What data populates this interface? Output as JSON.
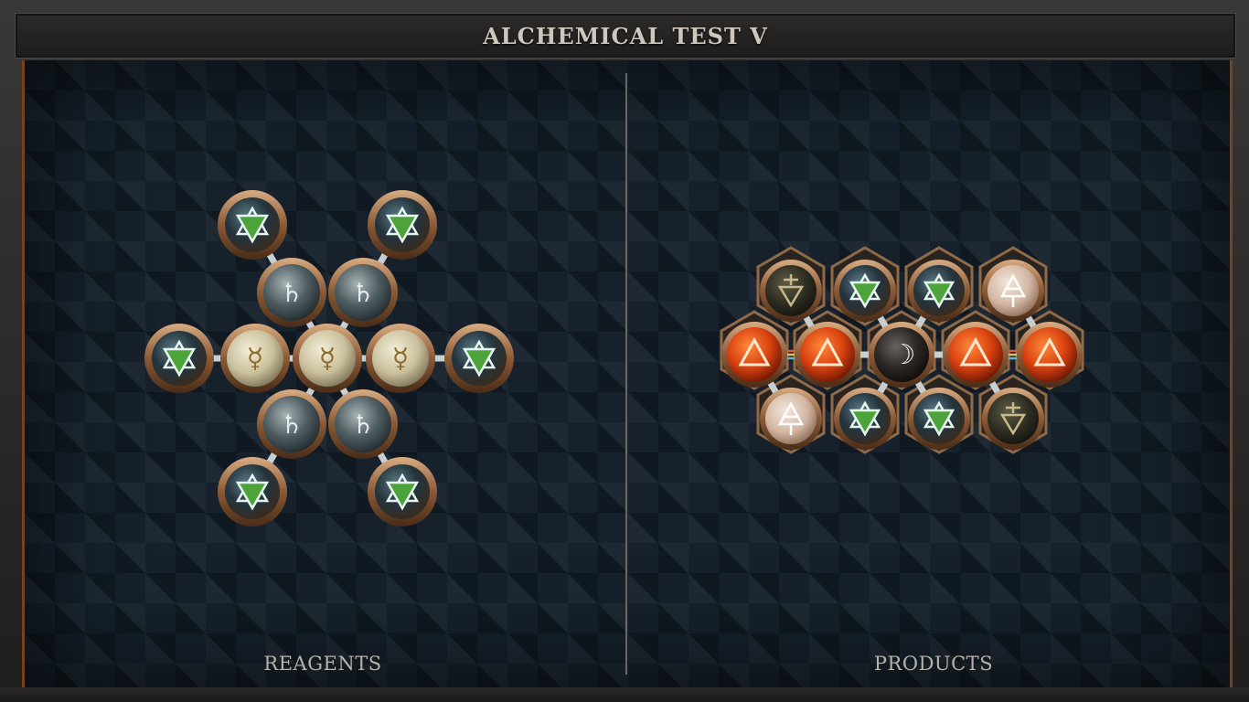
{
  "title": "ALCHEMICAL TEST V",
  "panels": {
    "reagents_label": "REAGENTS",
    "products_label": "PRODUCTS"
  },
  "colors": {
    "frame": "#2b2a29",
    "board": "#16212c",
    "accent_copper": "#7a3f1e",
    "bronze_rim": "#a77a52",
    "fire": "#d9420f",
    "salt": "#2f4754",
    "quicksilver": "#d8d0b4",
    "earth": "#3a3a2a",
    "air": "#d8c4b4",
    "moon": "#2c2c2c"
  },
  "reagent_molecule": {
    "atoms": [
      {
        "id": "salt-tl",
        "element": "salt",
        "symbol": "🜔"
      },
      {
        "id": "salt-tr",
        "element": "salt",
        "symbol": "🜔"
      },
      {
        "id": "lead-ul",
        "element": "lead",
        "symbol": "♄"
      },
      {
        "id": "lead-ur",
        "element": "lead",
        "symbol": "♄"
      },
      {
        "id": "salt-l",
        "element": "salt",
        "symbol": "🜔"
      },
      {
        "id": "qs-l",
        "element": "quicksilver",
        "symbol": "☿"
      },
      {
        "id": "qs-c",
        "element": "quicksilver",
        "symbol": "☿"
      },
      {
        "id": "qs-r",
        "element": "quicksilver",
        "symbol": "☿"
      },
      {
        "id": "salt-r",
        "element": "salt",
        "symbol": "🜔"
      },
      {
        "id": "lead-ll",
        "element": "lead",
        "symbol": "♄"
      },
      {
        "id": "lead-lr",
        "element": "lead",
        "symbol": "♄"
      },
      {
        "id": "salt-bl",
        "element": "salt",
        "symbol": "🜔"
      },
      {
        "id": "salt-br",
        "element": "salt",
        "symbol": "🜔"
      }
    ]
  },
  "product_molecule": {
    "atoms": [
      {
        "id": "earth-t1",
        "element": "earth",
        "symbol": "🜃"
      },
      {
        "id": "salt-t2",
        "element": "salt",
        "symbol": "🜔"
      },
      {
        "id": "salt-t3",
        "element": "salt",
        "symbol": "🜔"
      },
      {
        "id": "air-t4",
        "element": "air",
        "symbol": "🜁"
      },
      {
        "id": "fire-m1",
        "element": "fire",
        "symbol": "🜂"
      },
      {
        "id": "fire-m2",
        "element": "fire",
        "symbol": "🜂"
      },
      {
        "id": "moon-m3",
        "element": "silver",
        "symbol": "☽"
      },
      {
        "id": "fire-m4",
        "element": "fire",
        "symbol": "🜂"
      },
      {
        "id": "fire-m5",
        "element": "fire",
        "symbol": "🜂"
      },
      {
        "id": "air-b1",
        "element": "air",
        "symbol": "🜁"
      },
      {
        "id": "salt-b2",
        "element": "salt",
        "symbol": "🜔"
      },
      {
        "id": "salt-b3",
        "element": "salt",
        "symbol": "🜔"
      },
      {
        "id": "earth-b4",
        "element": "earth",
        "symbol": "🜃"
      }
    ]
  }
}
